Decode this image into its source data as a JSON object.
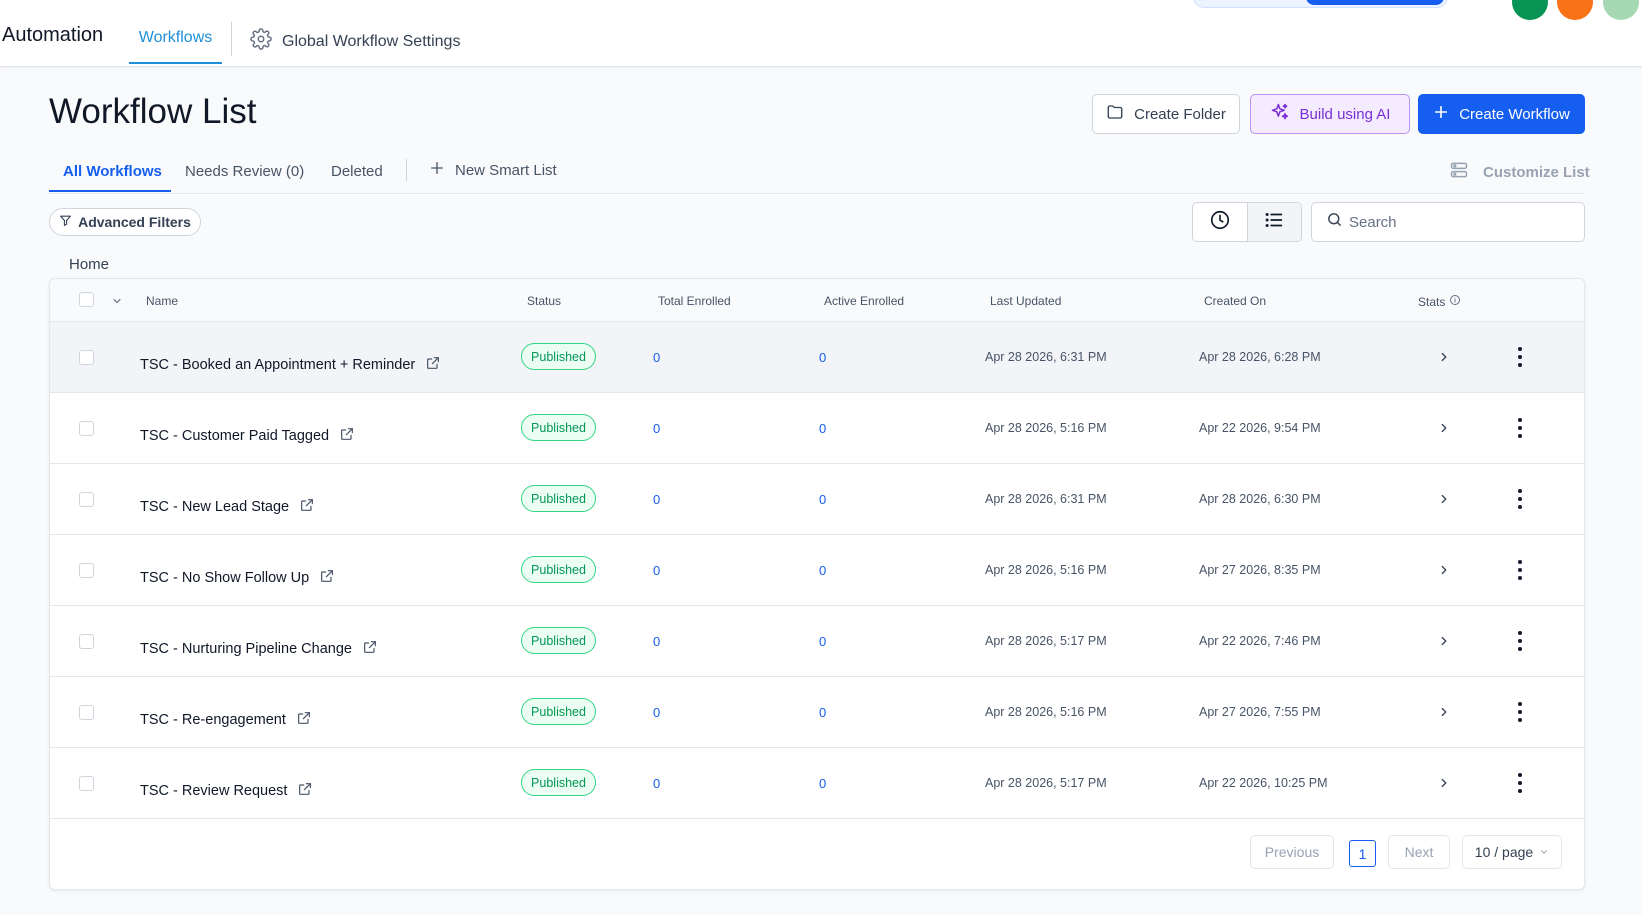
{
  "topbar": {
    "app_title": "Automation",
    "nav_tab": "Workflows",
    "settings_label": "Global Workflow Settings",
    "settings_icon": "gear-icon"
  },
  "header": {
    "title": "Workflow List",
    "create_folder": "Create Folder",
    "build_ai": "Build using AI",
    "create_workflow": "Create Workflow"
  },
  "tabs": {
    "all": "All Workflows",
    "needs_review": "Needs Review (0)",
    "deleted": "Deleted",
    "new_smart_list": "New Smart List",
    "customize_list": "Customize List"
  },
  "filters": {
    "advanced": "Advanced Filters",
    "search_placeholder": "Search"
  },
  "breadcrumb": "Home",
  "table": {
    "columns": {
      "name": "Name",
      "status": "Status",
      "total_enrolled": "Total Enrolled",
      "active_enrolled": "Active Enrolled",
      "last_updated": "Last Updated",
      "created_on": "Created On",
      "stats": "Stats"
    },
    "rows": [
      {
        "name": "TSC - Booked an Appointment + Reminder",
        "status": "Published",
        "total": "0",
        "active": "0",
        "updated": "Apr 28 2026, 6:31 PM",
        "created": "Apr 28 2026, 6:28 PM"
      },
      {
        "name": "TSC - Customer Paid Tagged",
        "status": "Published",
        "total": "0",
        "active": "0",
        "updated": "Apr 28 2026, 5:16 PM",
        "created": "Apr 22 2026, 9:54 PM"
      },
      {
        "name": "TSC - New Lead Stage",
        "status": "Published",
        "total": "0",
        "active": "0",
        "updated": "Apr 28 2026, 6:31 PM",
        "created": "Apr 28 2026, 6:30 PM"
      },
      {
        "name": "TSC - No Show Follow Up",
        "status": "Published",
        "total": "0",
        "active": "0",
        "updated": "Apr 28 2026, 5:16 PM",
        "created": "Apr 27 2026, 8:35 PM"
      },
      {
        "name": "TSC - Nurturing Pipeline Change",
        "status": "Published",
        "total": "0",
        "active": "0",
        "updated": "Apr 28 2026, 5:17 PM",
        "created": "Apr 22 2026, 7:46 PM"
      },
      {
        "name": "TSC - Re-engagement",
        "status": "Published",
        "total": "0",
        "active": "0",
        "updated": "Apr 28 2026, 5:16 PM",
        "created": "Apr 27 2026, 7:55 PM"
      },
      {
        "name": "TSC - Review Request",
        "status": "Published",
        "total": "0",
        "active": "0",
        "updated": "Apr 28 2026, 5:17 PM",
        "created": "Apr 22 2026, 10:25 PM"
      }
    ]
  },
  "pagination": {
    "previous": "Previous",
    "current_page": "1",
    "next": "Next",
    "page_size": "10 / page"
  },
  "colors": {
    "primary": "#155eef",
    "nav_accent": "#1f8fd9",
    "ai_purple": "#7a2ed6",
    "published_green": "#039855",
    "top_green": "#079455",
    "top_orange": "#f97316",
    "top_mint": "#a6d8b4"
  }
}
